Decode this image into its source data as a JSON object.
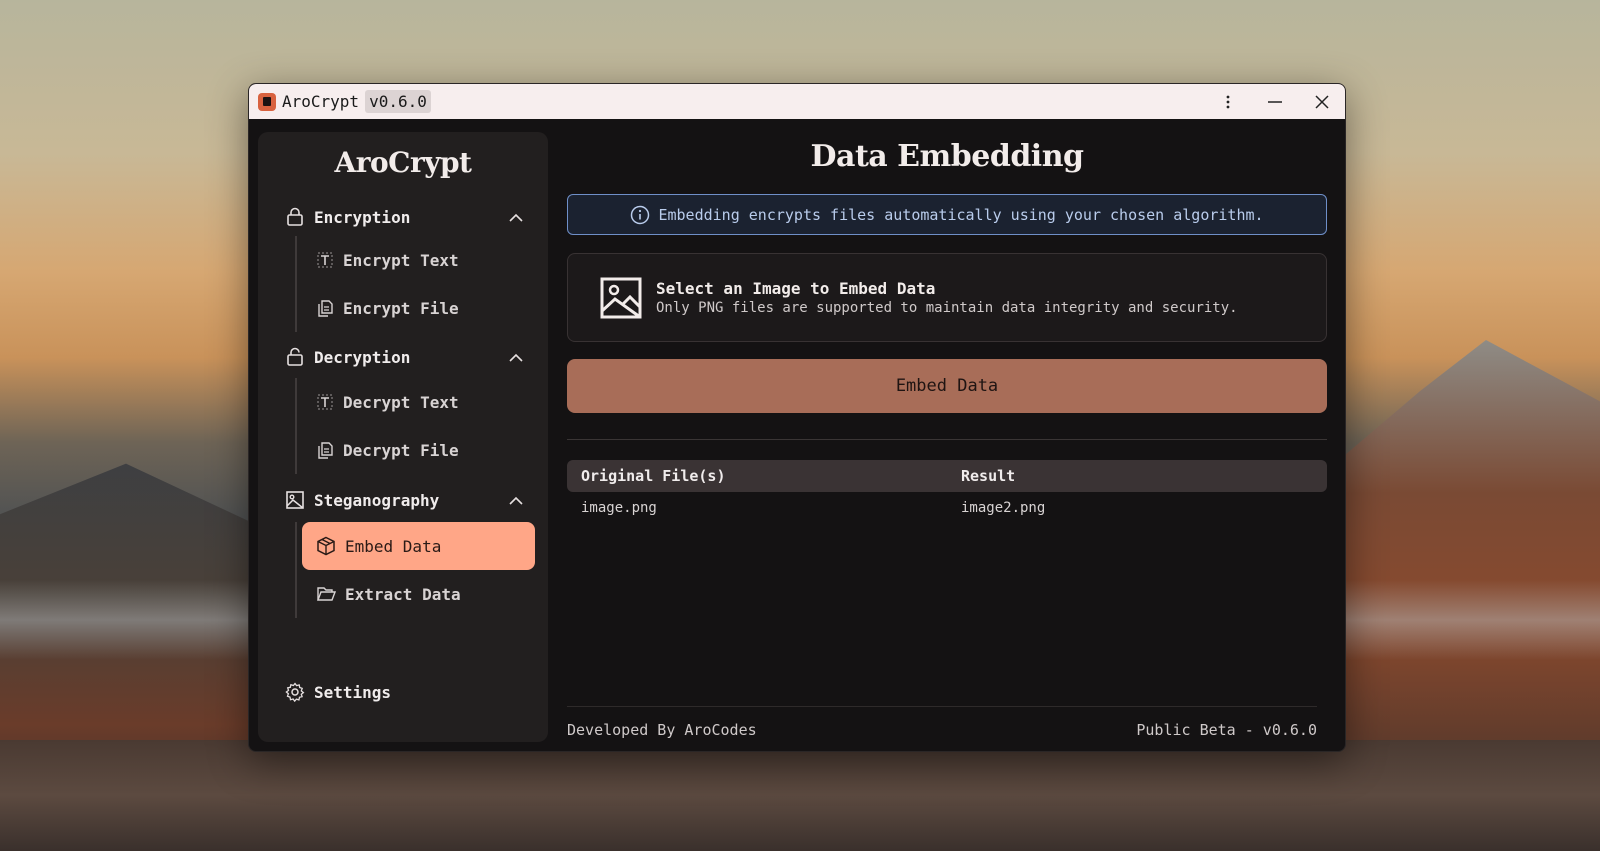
{
  "titlebar": {
    "app_name": "AroCrypt",
    "version": "v0.6.0",
    "icons": [
      "more-vertical-icon",
      "minimize-icon",
      "close-icon"
    ]
  },
  "sidebar": {
    "title": "AroCrypt",
    "sections": [
      {
        "label": "Encryption",
        "icon": "lock-icon",
        "items": [
          {
            "label": "Encrypt Text",
            "icon": "text-icon"
          },
          {
            "label": "Encrypt File",
            "icon": "files-icon"
          }
        ]
      },
      {
        "label": "Decryption",
        "icon": "unlock-icon",
        "items": [
          {
            "label": "Decrypt Text",
            "icon": "text-icon"
          },
          {
            "label": "Decrypt File",
            "icon": "files-icon"
          }
        ]
      },
      {
        "label": "Steganography",
        "icon": "image-icon",
        "items": [
          {
            "label": "Embed Data",
            "icon": "package-icon",
            "active": true
          },
          {
            "label": "Extract Data",
            "icon": "folder-open-icon"
          }
        ]
      }
    ],
    "settings_label": "Settings"
  },
  "main": {
    "title": "Data Embedding",
    "info_text": "Embedding encrypts files automatically using your chosen algorithm.",
    "select_card": {
      "title": "Select an Image to Embed Data",
      "subtitle": "Only PNG files are supported to maintain data integrity and security."
    },
    "embed_button": "Embed Data",
    "table": {
      "headers": [
        "Original File(s)",
        "Result"
      ],
      "rows": [
        [
          "image.png",
          "image2.png"
        ]
      ]
    },
    "footer_left": "Developed By AroCodes",
    "footer_right": "Public Beta - v0.6.0"
  },
  "colors": {
    "accent": "#ffa687",
    "button": "#a86d58",
    "info_border": "#6f8fc8"
  }
}
